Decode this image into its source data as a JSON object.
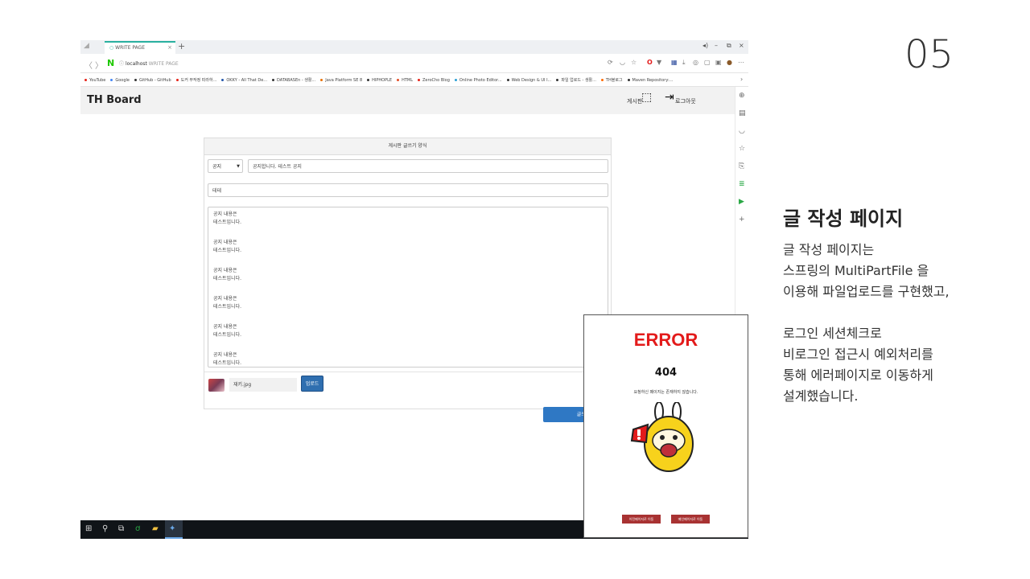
{
  "slide": {
    "number": "05",
    "title": "글 작성 페이지",
    "body": "글 작성 페이지는\n스프링의 MultiPartFile 을\n이용해 파일업로드를 구현했고,\n\n로그인 세션체크로\n비로그인 접근시 예외처리를\n통해 에러페이지로 이동하게\n설계했습니다."
  },
  "browser": {
    "tab_title": "WRITE PAGE",
    "url_host": "localhost",
    "url_title": "WRITE PAGE",
    "bookmarks": [
      {
        "label": "YouTube",
        "color": "#e62117"
      },
      {
        "label": "Google",
        "color": "#4285f4"
      },
      {
        "label": "GitHub - GitHub",
        "color": "#333333"
      },
      {
        "label": "도커 무작정 따라하...",
        "color": "#e62117"
      },
      {
        "label": "OKKY - All That De...",
        "color": "#2255aa"
      },
      {
        "label": "DATABASEn - 생활...",
        "color": "#333333"
      },
      {
        "label": "Java Platform SE 8",
        "color": "#e76f00"
      },
      {
        "label": "HIPHOPLE",
        "color": "#333333"
      },
      {
        "label": "HTML",
        "color": "#e34c26"
      },
      {
        "label": "ZeroCho Blog",
        "color": "#e62117"
      },
      {
        "label": "Online Photo Editor...",
        "color": "#2a9fd6"
      },
      {
        "label": "Web Design & UI I...",
        "color": "#333333"
      },
      {
        "label": "파일 업로드 - 생활...",
        "color": "#333333"
      },
      {
        "label": "TH블로그",
        "color": "#ff6a00"
      },
      {
        "label": "Maven Repository:...",
        "color": "#333333"
      }
    ]
  },
  "app": {
    "brand": "TH Board",
    "nav_board": "게시판",
    "nav_logout": "로그아웃",
    "form": {
      "heading": "게시판 글쓰기 양식",
      "category": "공지",
      "title_value": "공지합니다. 테스트 공지",
      "writer_value": "테테",
      "content_paragraphs": [
        "공지 내용은\n테스트입니다.",
        "공지 내용은\n테스트입니다.",
        "공지 내용은\n테스트입니다.",
        "공지 내용은\n테스트입니다.",
        "공지 내용은\n테스트입니다.",
        "공지 내용은\n테스트입니다."
      ],
      "file_name": "재키.jpg",
      "upload_label": "업로드",
      "submit_label": "글쓰기"
    }
  },
  "error_page": {
    "title": "ERROR",
    "code": "404",
    "message": "요청하신 페이지는 존재하지 않습니다.",
    "btn_prev": "이전페이지로 이동",
    "btn_main": "메인페이지로 이동"
  }
}
